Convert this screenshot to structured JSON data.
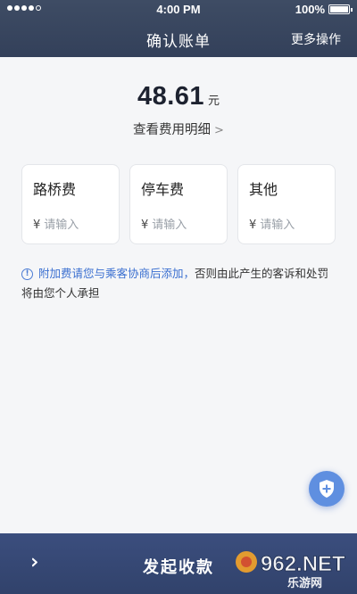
{
  "status_bar": {
    "time": "4:00 PM",
    "battery": "100%"
  },
  "nav": {
    "title": "确认账单",
    "action": "更多操作"
  },
  "summary": {
    "amount": "48.61",
    "unit": "元",
    "detail_link": "查看费用明细"
  },
  "fees": [
    {
      "label": "路桥费",
      "currency": "¥",
      "placeholder": "请输入"
    },
    {
      "label": "停车费",
      "currency": "¥",
      "placeholder": "请输入"
    },
    {
      "label": "其他",
      "currency": "¥",
      "placeholder": "请输入"
    }
  ],
  "notice": {
    "highlight": "附加费请您与乘客协商后添加，",
    "rest": "否则由此产生的客诉和处罚将由您个人承担"
  },
  "bottom_bar": {
    "label": "发起收款"
  },
  "watermark": {
    "line1": "962.NET",
    "line2": "乐游网"
  },
  "colors": {
    "header": "#3e4c64",
    "bottom_bar": "#3b4e7e",
    "accent_blue": "#3a6fd0",
    "fab": "#5f8fe0",
    "page_bg": "#f5f6f8"
  }
}
